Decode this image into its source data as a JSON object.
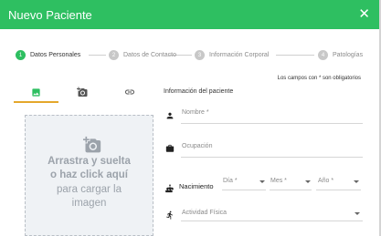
{
  "modal": {
    "title": "Nuevo Paciente",
    "close_icon": "close-icon",
    "colors": {
      "header": "#2ebf61",
      "accent": "#e4a72b"
    }
  },
  "stepper": {
    "steps": [
      {
        "number": "1",
        "label": "Datos Personales",
        "state": "active"
      },
      {
        "number": "2",
        "label": "Datos de Contacto",
        "state": "inactive"
      },
      {
        "number": "3",
        "label": "Información Corporal",
        "state": "inactive"
      },
      {
        "number": "4",
        "label": "Patologías",
        "state": "inactive"
      }
    ]
  },
  "required_note": "Los campos con * son obligatorios",
  "photo_panel": {
    "tabs": [
      {
        "icon": "image-icon",
        "selected": true
      },
      {
        "icon": "camera-icon",
        "selected": false
      },
      {
        "icon": "link-icon",
        "selected": false
      }
    ],
    "dropzone": {
      "line1": "Arrastra y suelta",
      "line2": "o haz click aquí",
      "line3": "para cargar la",
      "line4": "imagen"
    }
  },
  "form": {
    "section_title": "Información del paciente",
    "name_placeholder": "Nombre *",
    "occupation_placeholder": "Ocupación",
    "birth": {
      "label": "Nacimiento",
      "day_placeholder": "Día *",
      "month_placeholder": "Mes *",
      "year_placeholder": "Año *"
    },
    "activity_placeholder": "Actividad Física"
  }
}
